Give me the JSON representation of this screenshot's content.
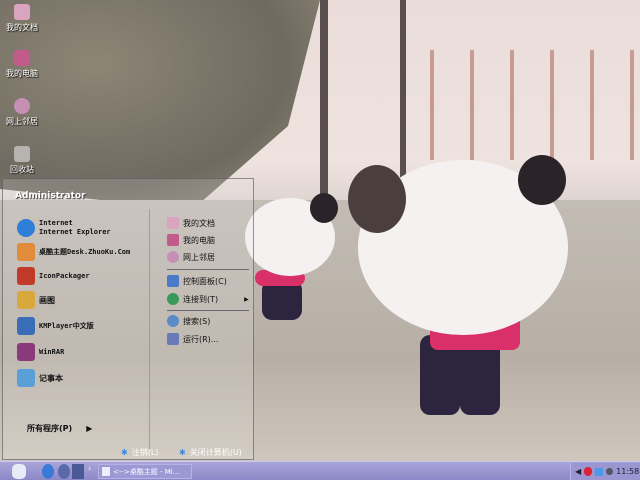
{
  "desktop": {
    "icons": [
      {
        "label": "我的文档",
        "color": "#d9a4bd"
      },
      {
        "label": "我的电脑",
        "color": "#c25a8b"
      },
      {
        "label": "网上邻居",
        "color": "#c690b5"
      },
      {
        "label": "回收站",
        "color": "#b7b3b0"
      }
    ]
  },
  "start_menu": {
    "user": "Administrator",
    "programs": [
      {
        "title": "Internet",
        "subtitle": "Internet Explorer",
        "icon": "ie-icon",
        "color": "#2f7fd8"
      },
      {
        "title": "桌酷主题Desk.ZhuoKu.Com",
        "icon": "theme-icon",
        "color": "#e08c3a"
      },
      {
        "title": "IconPackager",
        "icon": "iconpackager-icon",
        "color": "#c23a2a"
      },
      {
        "title": "画图",
        "icon": "paint-icon",
        "color": "#d8a93a"
      },
      {
        "title": "KMPlayer中文版",
        "icon": "kmplayer-icon",
        "color": "#3a6db8"
      },
      {
        "title": "WinRAR",
        "icon": "winrar-icon",
        "color": "#8a3a7a"
      },
      {
        "title": "记事本",
        "icon": "notepad-icon",
        "color": "#5aa0d8"
      }
    ],
    "all_programs": "所有程序(P)",
    "places": [
      {
        "label": "我的文档",
        "icon": "my-documents-icon",
        "color": "#d9a4bd"
      },
      {
        "label": "我的电脑",
        "icon": "my-computer-icon",
        "color": "#c25a8b"
      },
      {
        "label": "网上邻居",
        "icon": "network-icon",
        "color": "#c690b5"
      }
    ],
    "system": [
      {
        "label": "控制面板(C)",
        "icon": "control-panel-icon",
        "color": "#4a7ac8"
      },
      {
        "label": "连接到(T)",
        "icon": "connect-icon",
        "color": "#3a9a5a",
        "submenu": true
      }
    ],
    "tools": [
      {
        "label": "搜索(S)",
        "icon": "search-icon",
        "color": "#5a8ac8"
      },
      {
        "label": "运行(R)...",
        "icon": "run-icon",
        "color": "#6a7ab8"
      }
    ],
    "logoff": "注销(L)",
    "shutdown": "关闭计算机(U)"
  },
  "taskbar": {
    "task": "<-->桌酷主题 - Mi...",
    "clock": "11:58",
    "accent": "#8d88c8"
  }
}
